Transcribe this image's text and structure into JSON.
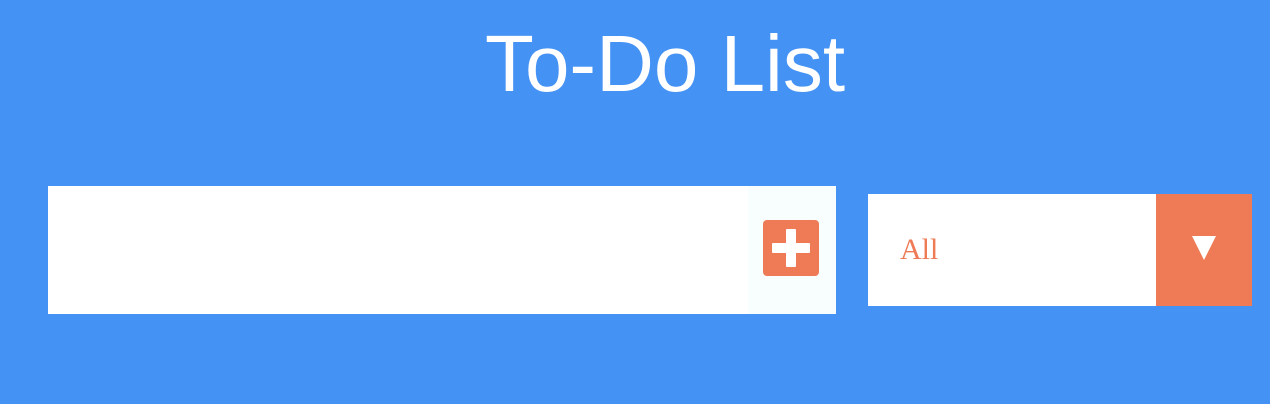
{
  "header": {
    "title": "To-Do List"
  },
  "todo_form": {
    "input_value": "",
    "add_icon": "plus-icon"
  },
  "filter": {
    "selected": "All",
    "dropdown_icon": "chevron-down-icon"
  },
  "colors": {
    "background": "#4592f5",
    "accent": "#ee7b55",
    "surface": "#ffffff"
  }
}
